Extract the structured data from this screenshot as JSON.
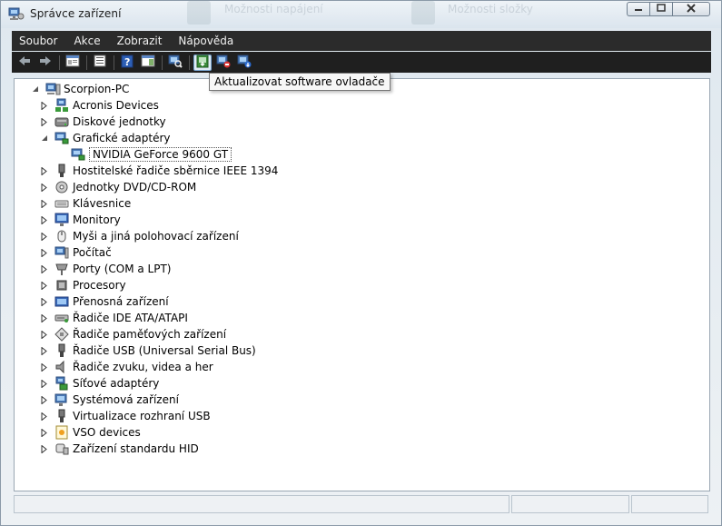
{
  "window": {
    "title": "Správce zařízení",
    "background_titles": [
      "Možnosti napájení",
      "Možnosti složky"
    ]
  },
  "menu": [
    {
      "label": "Soubor"
    },
    {
      "label": "Akce"
    },
    {
      "label": "Zobrazit"
    },
    {
      "label": "Nápověda"
    }
  ],
  "toolbar": {
    "tooltip": "Aktualizovat software ovladače",
    "buttons": [
      "back-icon",
      "forward-icon",
      "properties-pane-icon",
      "list-view-icon",
      "help-icon",
      "console-icon",
      "scan-hardware-icon",
      "update-driver-icon",
      "disable-device-icon",
      "uninstall-device-icon"
    ]
  },
  "tree": {
    "root": "Scorpion-PC",
    "items": [
      {
        "label": "Acronis Devices",
        "icon": "network-device-icon"
      },
      {
        "label": "Diskové jednotky",
        "icon": "disk-drive-icon"
      },
      {
        "label": "Grafické adaptéry",
        "icon": "display-adapter-icon",
        "expanded": true,
        "children": [
          {
            "label": "NVIDIA GeForce 9600 GT",
            "icon": "display-adapter-icon"
          }
        ]
      },
      {
        "label": "Hostitelské řadiče sběrnice IEEE 1394",
        "icon": "ieee1394-icon"
      },
      {
        "label": "Jednotky DVD/CD-ROM",
        "icon": "dvd-drive-icon"
      },
      {
        "label": "Klávesnice",
        "icon": "keyboard-icon"
      },
      {
        "label": "Monitory",
        "icon": "monitor-icon"
      },
      {
        "label": "Myši a jiná polohovací zařízení",
        "icon": "mouse-icon"
      },
      {
        "label": "Počítač",
        "icon": "computer-icon"
      },
      {
        "label": "Porty (COM a LPT)",
        "icon": "port-icon"
      },
      {
        "label": "Procesory",
        "icon": "processor-icon"
      },
      {
        "label": "Přenosná zařízení",
        "icon": "portable-device-icon"
      },
      {
        "label": "Řadiče IDE ATA/ATAPI",
        "icon": "ide-controller-icon"
      },
      {
        "label": "Řadiče paměťových zařízení",
        "icon": "storage-controller-icon"
      },
      {
        "label": "Řadiče USB (Universal Serial Bus)",
        "icon": "usb-icon"
      },
      {
        "label": "Řadiče zvuku, videa a her",
        "icon": "sound-icon"
      },
      {
        "label": "Síťové adaptéry",
        "icon": "network-adapter-icon"
      },
      {
        "label": "Systémová zařízení",
        "icon": "system-device-icon"
      },
      {
        "label": "Virtualizace rozhraní USB",
        "icon": "usb-icon"
      },
      {
        "label": "VSO devices",
        "icon": "vso-icon"
      },
      {
        "label": "Zařízení standardu HID",
        "icon": "hid-icon"
      }
    ]
  },
  "colors": {
    "menubar_bg": "#2b2b2b",
    "toolbar_bg": "#1f1f1f",
    "tree_bg": "#ffffff",
    "titlebar_bg": "#dbe5ee"
  }
}
